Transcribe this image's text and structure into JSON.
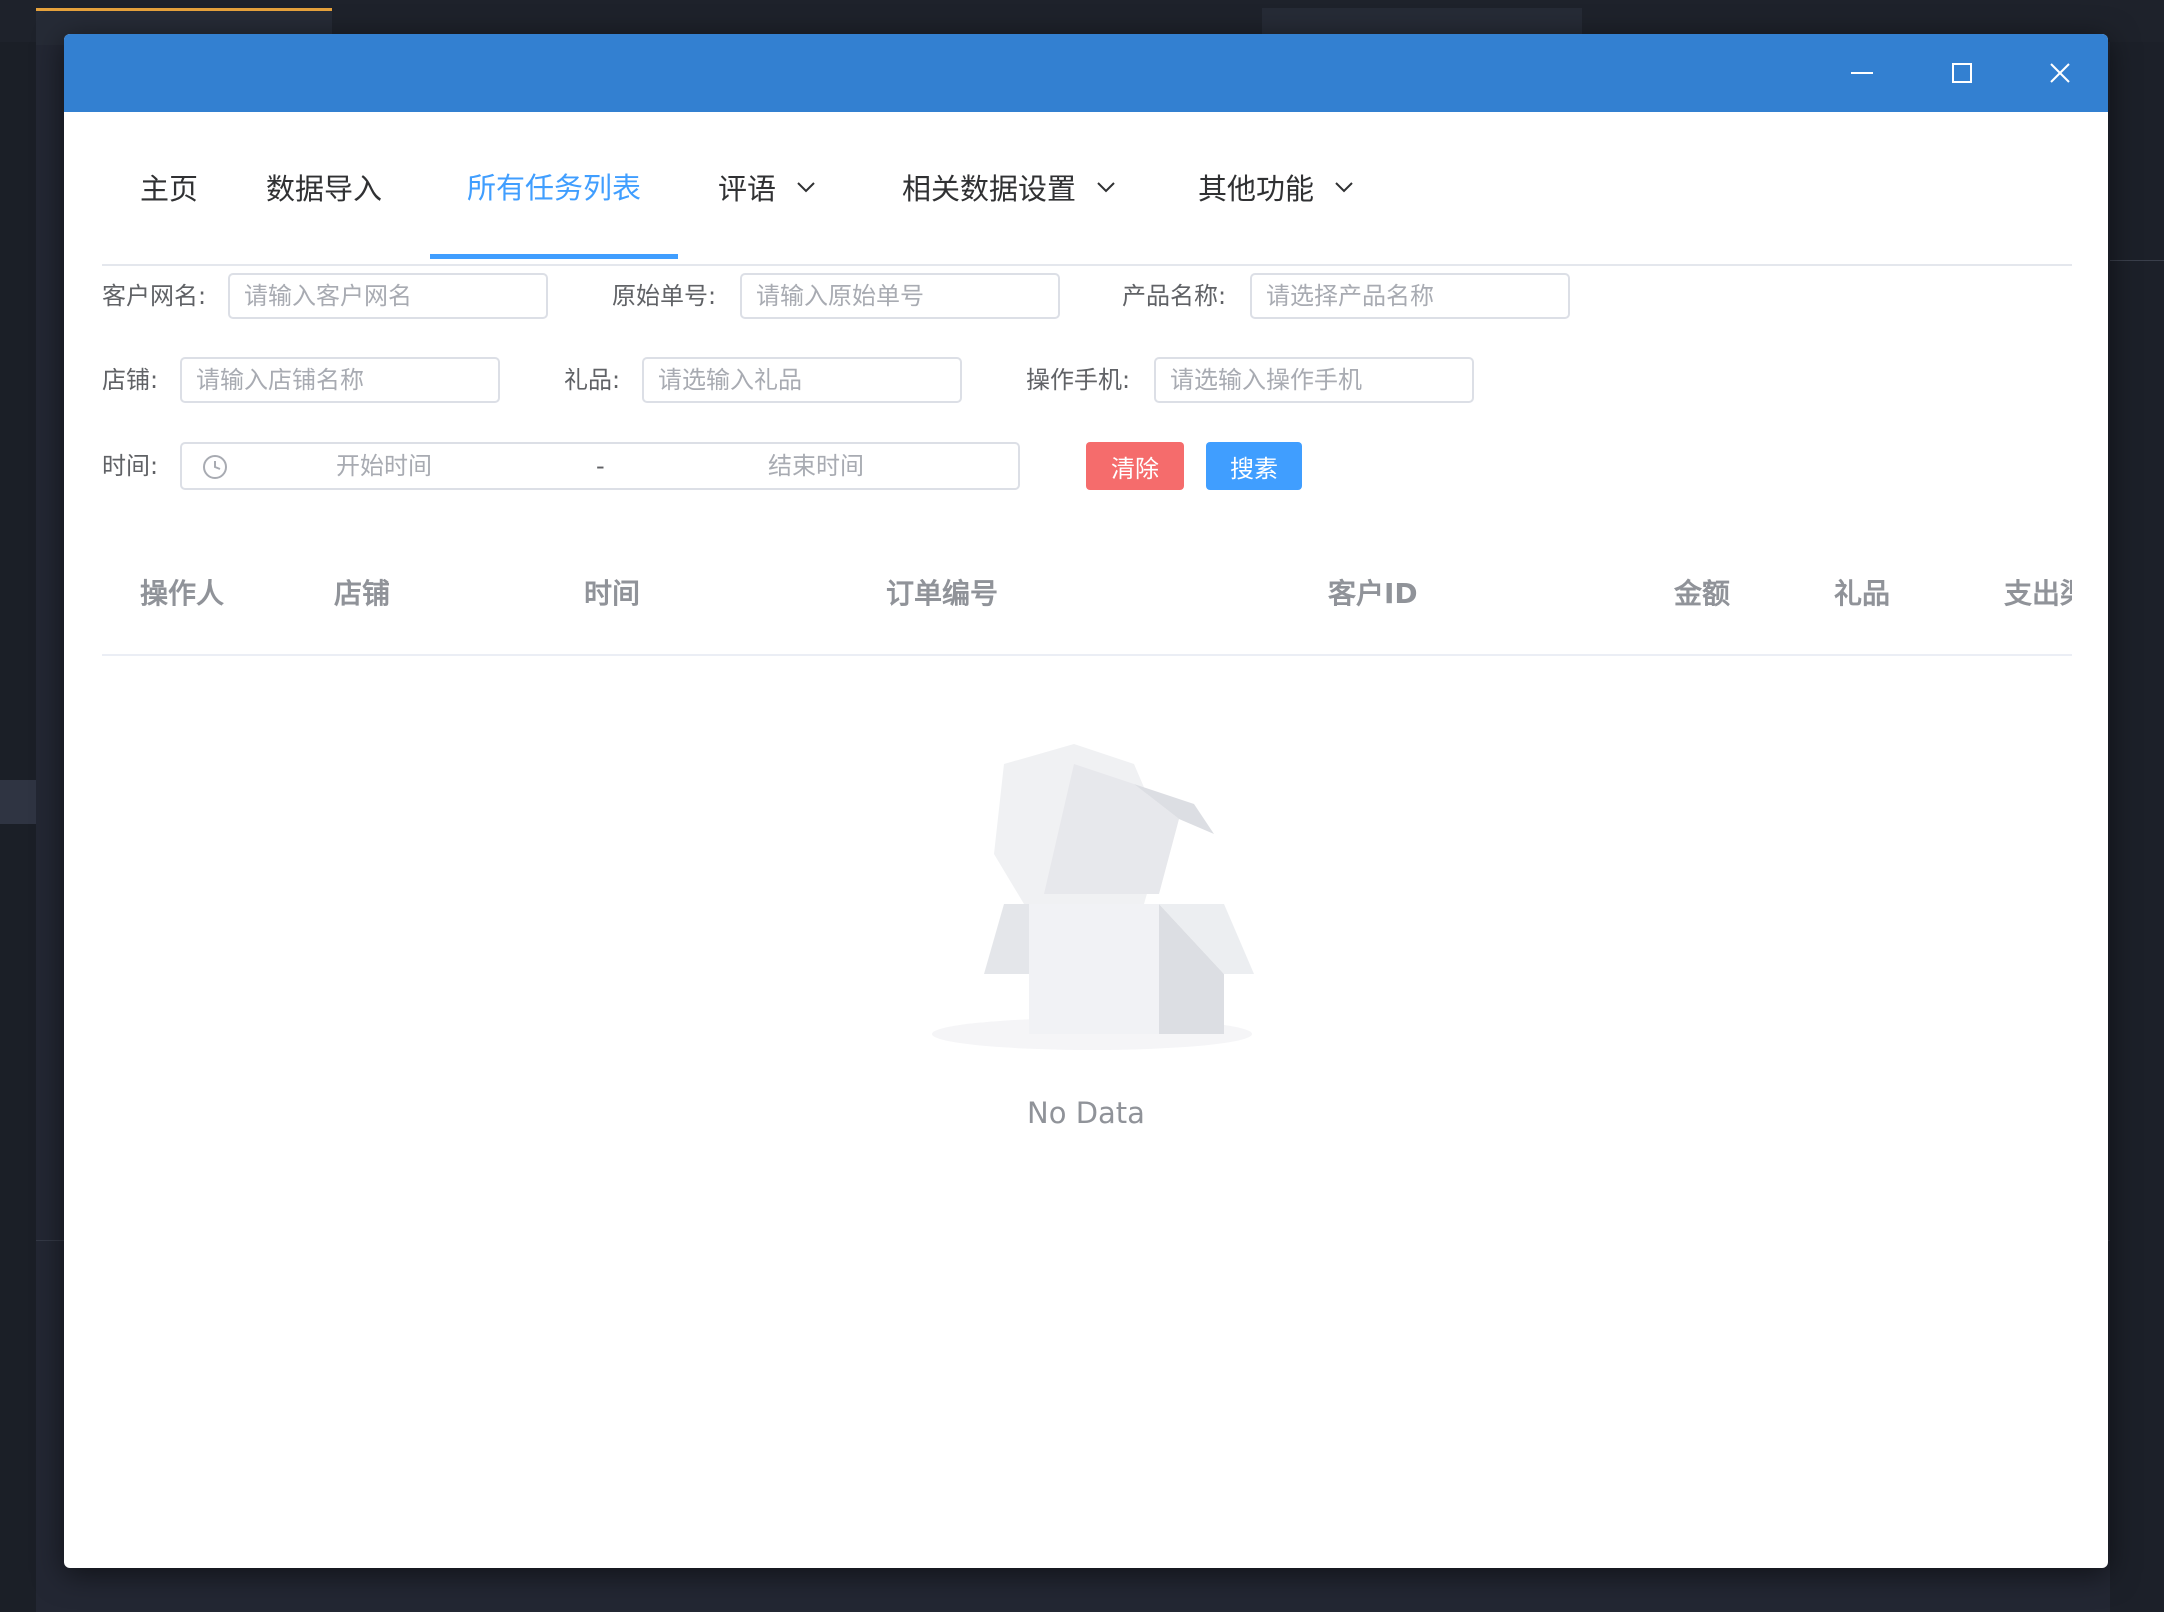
{
  "window": {
    "controls": {
      "minimize_icon": "minimize-icon",
      "maximize_icon": "maximize-icon",
      "close_icon": "close-icon"
    }
  },
  "nav": {
    "items": [
      {
        "label": "主页",
        "has_dropdown": false,
        "active": false
      },
      {
        "label": "数据导入",
        "has_dropdown": false,
        "active": false
      },
      {
        "label": "所有任务列表",
        "has_dropdown": false,
        "active": true
      },
      {
        "label": "评语",
        "has_dropdown": true,
        "active": false
      },
      {
        "label": "相关数据设置",
        "has_dropdown": true,
        "active": false
      },
      {
        "label": "其他功能",
        "has_dropdown": true,
        "active": false
      }
    ]
  },
  "filters": {
    "customer_name": {
      "label": "客户网名:",
      "placeholder": "请输入客户网名",
      "value": ""
    },
    "original_order": {
      "label": "原始单号:",
      "placeholder": "请输入原始单号",
      "value": ""
    },
    "product_name": {
      "label": "产品名称:",
      "placeholder": "请选择产品名称",
      "value": ""
    },
    "store": {
      "label": "店铺:",
      "placeholder": "请输入店铺名称",
      "value": ""
    },
    "gift": {
      "label": "礼品:",
      "placeholder": "请选输入礼品",
      "value": ""
    },
    "operator_phone": {
      "label": "操作手机:",
      "placeholder": "请选输入操作手机",
      "value": ""
    },
    "time": {
      "label": "时间:",
      "start_placeholder": "开始时间",
      "separator": "-",
      "end_placeholder": "结束时间"
    },
    "clear_label": "清除",
    "search_label": "搜素"
  },
  "table": {
    "columns": [
      "操作人",
      "店铺",
      "时间",
      "订单编号",
      "客户ID",
      "金额",
      "礼品",
      "支出渠道"
    ],
    "rows": [],
    "empty_text": "No Data"
  },
  "colors": {
    "titlebar": "#3380d1",
    "accent": "#409eff",
    "danger": "#f56c6c"
  }
}
